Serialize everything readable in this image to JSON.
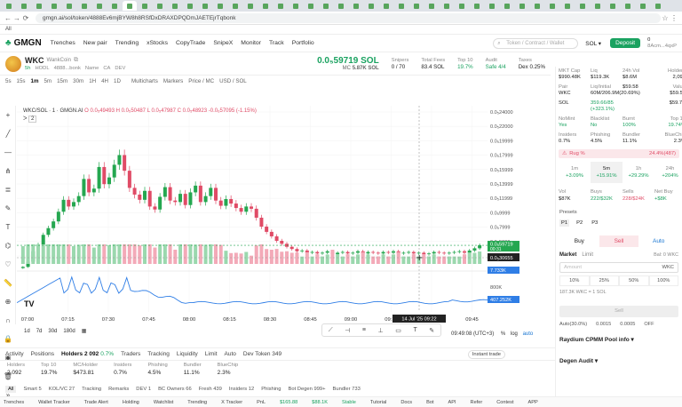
{
  "browser": {
    "url": "gmgn.ai/sol/token/4888Ev6mjBYW8h8RSfDxDRAXDPQDmJAETEjrTqbonk",
    "bookmark": "All"
  },
  "nav": {
    "logo": "GMGN",
    "items": [
      "Trenches",
      "New pair",
      "Trending",
      "xStocks",
      "CopyTrade",
      "SnipeX",
      "Monitor",
      "Track",
      "Portfolio"
    ],
    "search_placeholder": "Token / Contract / Wallet",
    "chain": "SOL",
    "deposit": "Deposit",
    "wallet_balance": "0",
    "wallet_addr": "8Acm...4qxP"
  },
  "token": {
    "symbol": "WKC",
    "name": "WankCoin",
    "age": "5h",
    "holders_short": "HODL",
    "address": "4888...bonk",
    "tags": [
      "Name",
      "CA",
      "DEV"
    ],
    "price": "0.0₅59719 SOL",
    "mc_label": "MC",
    "mc_value": "5.87K SOL",
    "stats": [
      {
        "label": "Snipers",
        "value": "0 / 70"
      },
      {
        "label": "Total Fees",
        "value": "83.4 SOL"
      },
      {
        "label": "Top 10",
        "value": "19.7%"
      },
      {
        "label": "Audit",
        "value": "Safe 4/4"
      },
      {
        "label": "Taxes",
        "value": "Dex 0.25%"
      }
    ]
  },
  "chart_toolbar": {
    "intervals": [
      "5s",
      "15s",
      "1m",
      "5m",
      "15m",
      "30m",
      "1H",
      "4H",
      "1D"
    ],
    "selected": "1m",
    "multichart": "Multicharts",
    "markers": "Markers",
    "price_mc": "Price / MC",
    "usd_sol": "USD / SOL"
  },
  "chart_legend": {
    "title": "WKC/SOL · 1 · GMGN.AI",
    "o": "O 0.0₅49493",
    "h": "H 0.0₅50487",
    "l": "L 0.0₅47987",
    "c": "C 0.0₅48923",
    "chg": "-0.0₆57095 (-1.15%)",
    "count": "2"
  },
  "chart_data": {
    "type": "candlestick",
    "x_ticks": [
      "07:00",
      "07:15",
      "07:30",
      "07:45",
      "08:00",
      "08:15",
      "08:30",
      "08:45",
      "09:00",
      "09:15",
      "09:30",
      "09:45"
    ],
    "y_ticks": [
      "0.0₅24000",
      "0.0₅22000",
      "0.0₅19999",
      "0.0₅17999",
      "0.0₅15999",
      "0.0₅13999",
      "0.0₅11999",
      "0.0₅9999",
      "0.0₅7999",
      "0.0₅5999",
      "0.0₅3999"
    ],
    "y_min": 3.5e-06,
    "y_max": 2.4e-05,
    "current_price_label": "0.0₅59719",
    "current_price_sub": "00:31",
    "crosshair_label": "0.0₅30655",
    "volume_label": "7.733K",
    "indicator_axis": "800K",
    "indicator_label": "407.252K",
    "crosshair_time": "14 Jul '25  09:22",
    "closes": [
      3.1e-06,
      3.8e-06,
      5.2e-06,
      6.1e-06,
      7.4e-06,
      8.3e-06,
      9.2e-06,
      1.05e-05,
      1.21e-05,
      1.12e-05,
      1.18e-05,
      1.26e-05,
      1.49e-05,
      1.31e-05,
      1.36e-05,
      1.65e-05,
      1.42e-05,
      1.51e-05,
      1.68e-05,
      1.81e-05,
      1.6e-05,
      1.37e-05,
      1.28e-05,
      1.21e-05,
      1.33e-05,
      1.12e-05,
      1.08e-05,
      1.25e-05,
      1.38e-05,
      1.2e-05,
      1.18e-05,
      1.29e-05,
      1.14e-05,
      1.31e-05,
      1.4e-05,
      1.18e-05,
      1.26e-05,
      1.37e-05,
      1.2e-05,
      1.13e-05,
      1.22e-05,
      1.16e-05,
      1.1e-05,
      1.05e-05,
      1.12e-05,
      1.09e-05,
      9.7e-06,
      8.5e-06,
      7.8e-06,
      7.2e-06,
      6.6e-06,
      6.2e-06,
      5.8e-06,
      5.5e-06,
      5.2e-06,
      5.3e-06,
      5e-06,
      5.1e-06,
      4.9e-06,
      5e-06,
      5.2e-06,
      4.8e-06,
      5e-06,
      5.1e-06,
      4.9e-06,
      5e-06,
      5.2e-06,
      4.9e-06,
      5.1e-06,
      5e-06,
      4.9e-06,
      5.1e-06,
      5e-06,
      5.2e-06,
      4.9e-06,
      5e-06,
      5.1e-06,
      4.9e-06,
      5e-06,
      4.8e-06,
      4.9e-06,
      5.1e-06,
      5e-06,
      4.9e-06,
      5e-06,
      5.1e-06,
      5.2e-06,
      5e-06,
      5.3e-06,
      5.6e-06,
      6e-06
    ]
  },
  "range_bar": {
    "ranges": [
      "1d",
      "7d",
      "30d",
      "180d"
    ],
    "clock": "09:49:08 (UTC+3)",
    "pct": "%",
    "log": "log",
    "auto": "auto"
  },
  "bottom_tabs": {
    "tabs": [
      "Activity",
      "Positions",
      "Holders 2 092",
      "Traders",
      "Tracking",
      "Liquidity",
      "Limit",
      "Auto",
      "Dev Token 349"
    ],
    "holder_change": "0.7%",
    "instant_trade": "Instant trade"
  },
  "bottom_stats": [
    {
      "label": "Holders",
      "value": "2 092"
    },
    {
      "label": "Top 10",
      "value": "19.7%"
    },
    {
      "label": "MC/Holder",
      "value": "$473.81"
    },
    {
      "label": "Insiders",
      "value": "0.7%"
    },
    {
      "label": "Phishing",
      "value": "4.5%"
    },
    {
      "label": "Bundler",
      "value": "11.1%"
    },
    {
      "label": "BlueChip",
      "value": "2.3%"
    }
  ],
  "filters": [
    "All",
    "Smart 5",
    "KOL/VC 27",
    "Tracking",
    "Remarks",
    "DEV 1",
    "BC Owners 66",
    "Fresh 439",
    "Insiders 12",
    "Phishing",
    "Bot Degen 999+",
    "Bundler 733"
  ],
  "footer": {
    "items": [
      "Trenches",
      "Wallet Tracker",
      "Trade Alert",
      "Holding",
      "Watchlist",
      "Trending",
      "X Tracker",
      "PnL",
      "$165.88",
      "$88.1K",
      "Stable",
      "Tutorial",
      "Docs",
      "Bot",
      "API",
      "Refer",
      "Contest",
      "APP"
    ]
  },
  "right_panel": {
    "row1": [
      {
        "label": "MKT Cap",
        "value": "$990.48K"
      },
      {
        "label": "Liq",
        "value": "$119.3K"
      },
      {
        "label": "24h Vol",
        "value": "$8.6M"
      },
      {
        "label": "Holders",
        "value": "2,092"
      }
    ],
    "row2": [
      {
        "label": "Pair",
        "value": "WKC"
      },
      {
        "label": "Liq/Initial",
        "value": "60M/206.9M(20.69%)"
      },
      {
        "label": "",
        "value": "$59.58"
      },
      {
        "label": "Value",
        "value": "$59.58"
      }
    ],
    "row2b": [
      {
        "value": "SOL"
      },
      {
        "value": "359.66/85 (+323.1%)"
      },
      {
        "value": ""
      },
      {
        "value": "$59.7K"
      }
    ],
    "row3": [
      {
        "label": "NoMint",
        "value": "Yes"
      },
      {
        "label": "Blacklist",
        "value": "No"
      },
      {
        "label": "Burnt",
        "value": "100%"
      },
      {
        "label": "Top 10",
        "value": "19.74%"
      }
    ],
    "row4": [
      {
        "label": "Insiders",
        "value": "0.7%"
      },
      {
        "label": "Phishing",
        "value": "4.5%"
      },
      {
        "label": "Bundler",
        "value": "11.1%"
      },
      {
        "label": "BlueChip",
        "value": "2.3%"
      }
    ],
    "rug_label": "Rug %",
    "rug_value": "24.4%(487)",
    "timeframes": [
      {
        "t": "1m",
        "v": "+3.09%"
      },
      {
        "t": "5m",
        "v": "+15.91%"
      },
      {
        "t": "1h",
        "v": "+29.29%"
      },
      {
        "t": "24h",
        "v": "+204%"
      }
    ],
    "vbs": [
      {
        "label": "Vol",
        "value": "$87K"
      },
      {
        "label": "Buys",
        "value": "222/$32K"
      },
      {
        "label": "Sells",
        "value": "228/$24K"
      },
      {
        "label": "Net Buy",
        "value": "+$8K"
      }
    ],
    "presets_label": "Presets",
    "presets": [
      "P1",
      "P2",
      "P3"
    ],
    "buy": "Buy",
    "sell": "Sell",
    "auto": "Auto",
    "market": "Market",
    "limit": "Limit",
    "bal": "Bal: 0 WKC",
    "amount_placeholder": "Amount",
    "amount_unit": "WKC",
    "pcts": [
      "10%",
      "25%",
      "50%",
      "100%"
    ],
    "est": "187.3K WKC = 1 SOL",
    "sell_btn": "Sell",
    "opts": [
      "Auto(30.0%)",
      "0.0015",
      "0.0005",
      "OFF"
    ],
    "raydium": "Raydium CPMM Pool info",
    "degen": "Degen Audit"
  }
}
